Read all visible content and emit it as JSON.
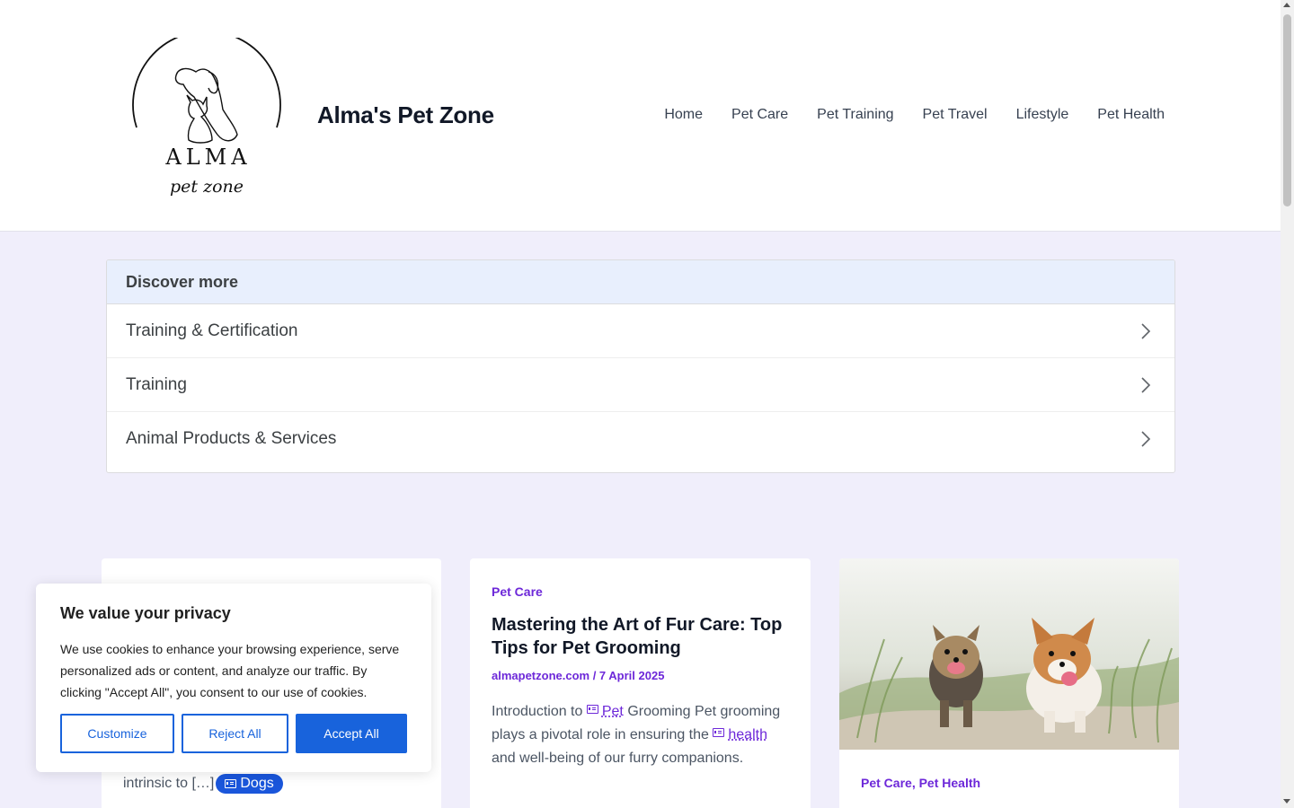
{
  "header": {
    "logo": {
      "brand": "ALMA",
      "tagline": "pet zone"
    },
    "site_title": "Alma's Pet Zone",
    "nav": [
      "Home",
      "Pet Care",
      "Pet Training",
      "Pet Travel",
      "Lifestyle",
      "Pet Health"
    ]
  },
  "discover": {
    "heading": "Discover more",
    "items": [
      "Training & Certification",
      "Training",
      "Animal Products & Services"
    ]
  },
  "cards": {
    "left": {
      "excerpt_tail": "intrinsic to […]",
      "tag": "Dogs"
    },
    "middle": {
      "category": "Pet Care",
      "title": "Mastering the Art of Fur Care: Top Tips for Pet Grooming",
      "meta": "almapetzone.com / 7 April 2025",
      "excerpt_1": "Introduction to",
      "kw_1": "Pet",
      "excerpt_2": "Grooming Pet grooming plays a pivotal role in ensuring the",
      "kw_2": "health",
      "excerpt_3": "and well-being of our furry companions."
    },
    "right": {
      "cat_1": "Pet Care",
      "sep": ",",
      "cat_2": "Pet Health"
    }
  },
  "cookie": {
    "title": "We value your privacy",
    "text": "We use cookies to enhance your browsing experience, serve personalized ads or content, and analyze our traffic. By clicking \"Accept All\", you consent to our use of cookies.",
    "customize": "Customize",
    "reject": "Reject All",
    "accept": "Accept All"
  },
  "colors": {
    "accent_purple": "#6d28d9",
    "primary_blue": "#1863dc",
    "page_bg": "#f0eefb"
  }
}
